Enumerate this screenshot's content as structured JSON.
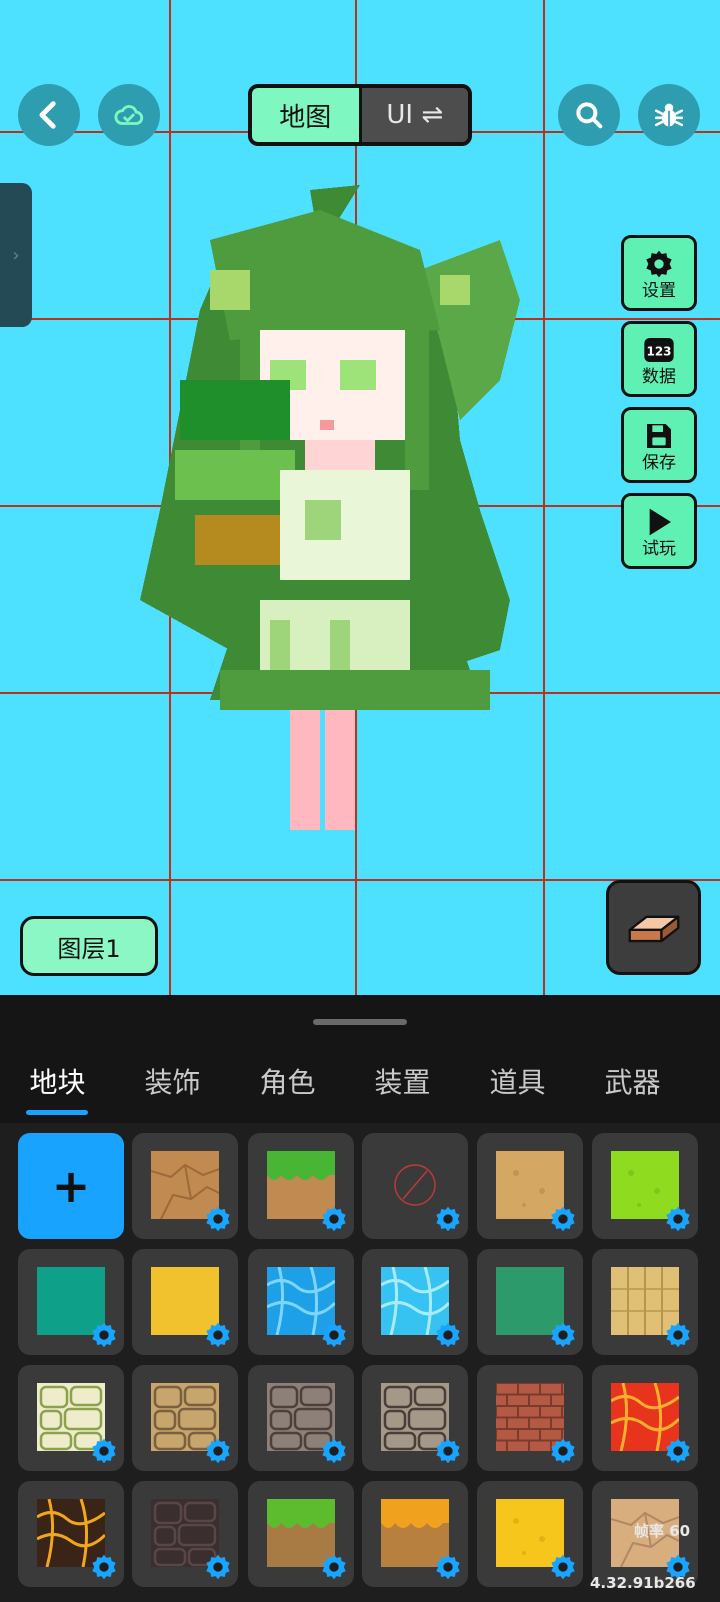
{
  "header": {
    "back_icon": "chevron-left-icon",
    "cloud_icon": "cloud-check-icon",
    "mode_tabs": [
      {
        "label": "地图",
        "active": true
      },
      {
        "label": "UI ⇌",
        "active": false
      }
    ],
    "search_icon": "search-icon",
    "bug_icon": "bug-icon"
  },
  "side_tools": [
    {
      "label": "设置",
      "icon": "gear-icon"
    },
    {
      "label": "数据",
      "icon": "data-123-icon"
    },
    {
      "label": "保存",
      "icon": "floppy-save-icon"
    },
    {
      "label": "试玩",
      "icon": "play-icon"
    }
  ],
  "layer": {
    "label": "图层1"
  },
  "eraser": {
    "icon": "eraser-icon"
  },
  "drawer": {
    "icon": "chevron-right-icon"
  },
  "panel": {
    "tabs": [
      "地块",
      "装饰",
      "角色",
      "装置",
      "道具",
      "武器"
    ],
    "active_tab": 0,
    "add_label": "+",
    "tiles": [
      {
        "name": "dirt-cracked",
        "colors": [
          "#c08a50",
          "#9c6a38"
        ]
      },
      {
        "name": "grass-dirt",
        "colors": [
          "#49b534",
          "#c08a50"
        ]
      },
      {
        "name": "empty",
        "colors": [
          "#3a3a3a",
          "#c03a3a"
        ]
      },
      {
        "name": "sand",
        "colors": [
          "#d4a762",
          "#c4954f"
        ]
      },
      {
        "name": "grass-plain",
        "colors": [
          "#8fdb1f",
          "#7cc81a"
        ]
      },
      {
        "name": "teal-solid",
        "colors": [
          "#0fa08a",
          "#0fa08a"
        ]
      },
      {
        "name": "yellow-solid",
        "colors": [
          "#f2c12e",
          "#f2c12e"
        ]
      },
      {
        "name": "water-deep",
        "colors": [
          "#1ea0e8",
          "#7dd6ff"
        ]
      },
      {
        "name": "water-light",
        "colors": [
          "#37c3f2",
          "#a8ecff"
        ]
      },
      {
        "name": "green-solid",
        "colors": [
          "#2d9a6c",
          "#2d9a6c"
        ]
      },
      {
        "name": "wood-planks",
        "colors": [
          "#e0c074",
          "#b8954e"
        ]
      },
      {
        "name": "cobble-moss",
        "colors": [
          "#efeccc",
          "#8aa24e"
        ]
      },
      {
        "name": "stone-tan",
        "colors": [
          "#c6a66c",
          "#7a6040"
        ]
      },
      {
        "name": "stone-gray",
        "colors": [
          "#8c8078",
          "#4e3f3a"
        ]
      },
      {
        "name": "stone-mixed",
        "colors": [
          "#a49888",
          "#4a3e3a"
        ]
      },
      {
        "name": "brick",
        "colors": [
          "#b45a44",
          "#7a3a2c"
        ]
      },
      {
        "name": "lava",
        "colors": [
          "#e8331d",
          "#ffb02e"
        ]
      },
      {
        "name": "magma-dark",
        "colors": [
          "#3a2418",
          "#f0a818"
        ]
      },
      {
        "name": "rock-dark",
        "colors": [
          "#3a2e2e",
          "#5a4646"
        ]
      },
      {
        "name": "grass-dirt-2",
        "colors": [
          "#5cbc2e",
          "#a87a44"
        ]
      },
      {
        "name": "autumn-grass",
        "colors": [
          "#f0a21e",
          "#b8803e"
        ]
      },
      {
        "name": "gold-field",
        "colors": [
          "#f6c61c",
          "#e8ae12"
        ]
      },
      {
        "name": "sand-pebbles",
        "colors": [
          "#d8ae7e",
          "#b08866"
        ]
      }
    ]
  },
  "overlay": {
    "fps": "帧率 60",
    "version": "4.32.91b266"
  },
  "colors": {
    "canvas_bg": "#4ee0ff",
    "grid_line": "#b83220",
    "accent_green": "#7ef7c0",
    "accent_blue": "#17a3ff",
    "panel_bg": "#151515"
  }
}
